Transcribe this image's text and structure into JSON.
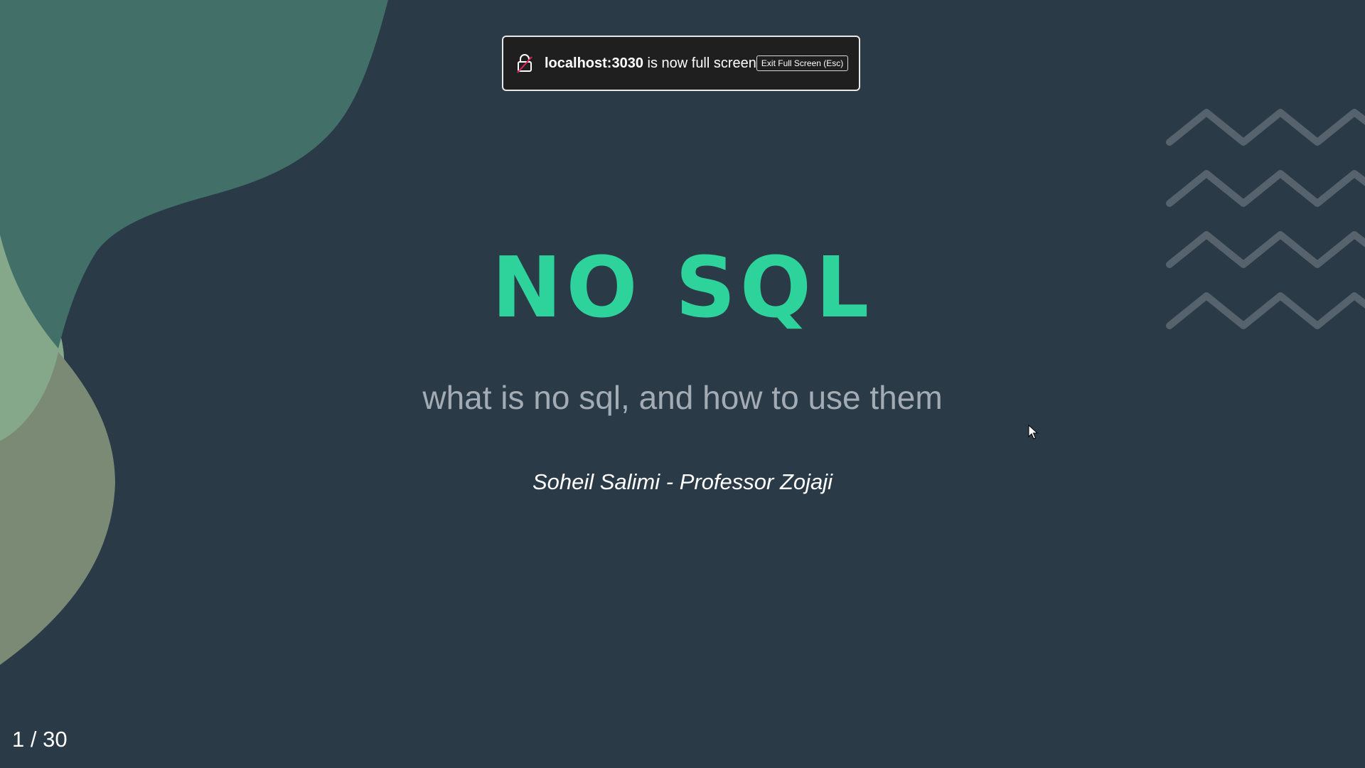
{
  "fullscreen_banner": {
    "host": "localhost:3030",
    "message": " is now full screen",
    "exit_button": "Exit Full Screen (Esc)",
    "icon": "unlock-icon"
  },
  "slide": {
    "title": "NO SQL",
    "subtitle": "what is no sql, and how to use them",
    "author": "Soheil Salimi - Professor Zojaji",
    "page_indicator": "1 / 30"
  },
  "decorations": {
    "blob_icon": "abstract-blob-shapes",
    "zigzag_icon": "zigzag-lines-icon"
  },
  "colors": {
    "background": "#2b3a47",
    "title": "#2ed39b",
    "subtitle": "#a3acb4",
    "author": "#ffffff",
    "blob_teal": "#427068",
    "blob_sage": "#86a88a",
    "blob_olive": "#7a8a74",
    "zigzag": "#56626c"
  }
}
